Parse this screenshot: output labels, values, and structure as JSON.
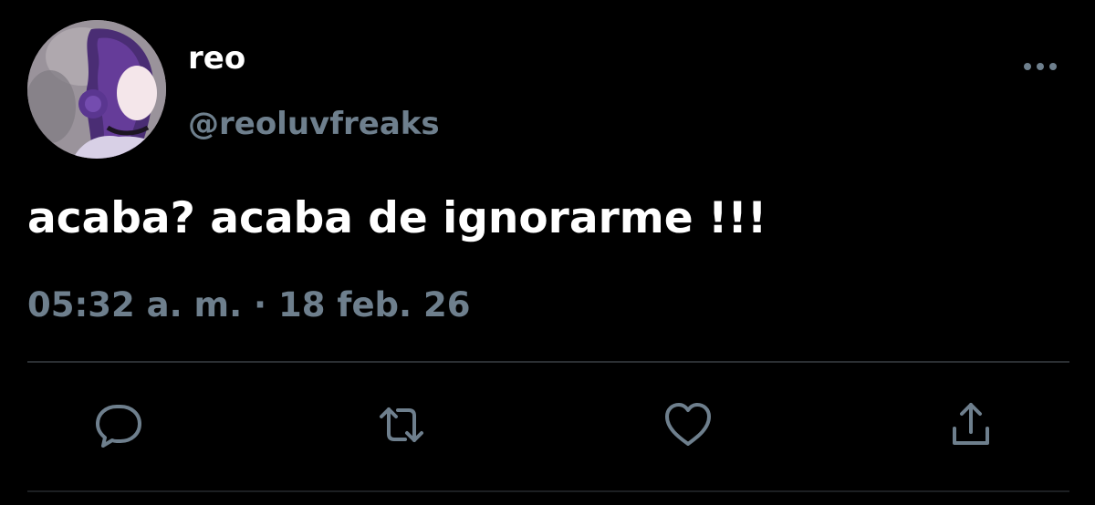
{
  "author": {
    "display_name": "reo",
    "handle": "@reoluvfreaks"
  },
  "tweet": {
    "text": "acaba? acaba de ignorarme !!!",
    "timestamp": "05:32 a. m. · 18 feb. 26"
  },
  "icons": {
    "more": "more-horizontal-icon",
    "reply": "reply-icon",
    "retweet": "retweet-icon",
    "like": "heart-icon",
    "share": "share-icon"
  },
  "colors": {
    "background": "#000000",
    "primary_text": "#ffffff",
    "secondary_text": "#6e7f8d",
    "icon": "#6e7f8d",
    "divider": "#2b2f33"
  }
}
